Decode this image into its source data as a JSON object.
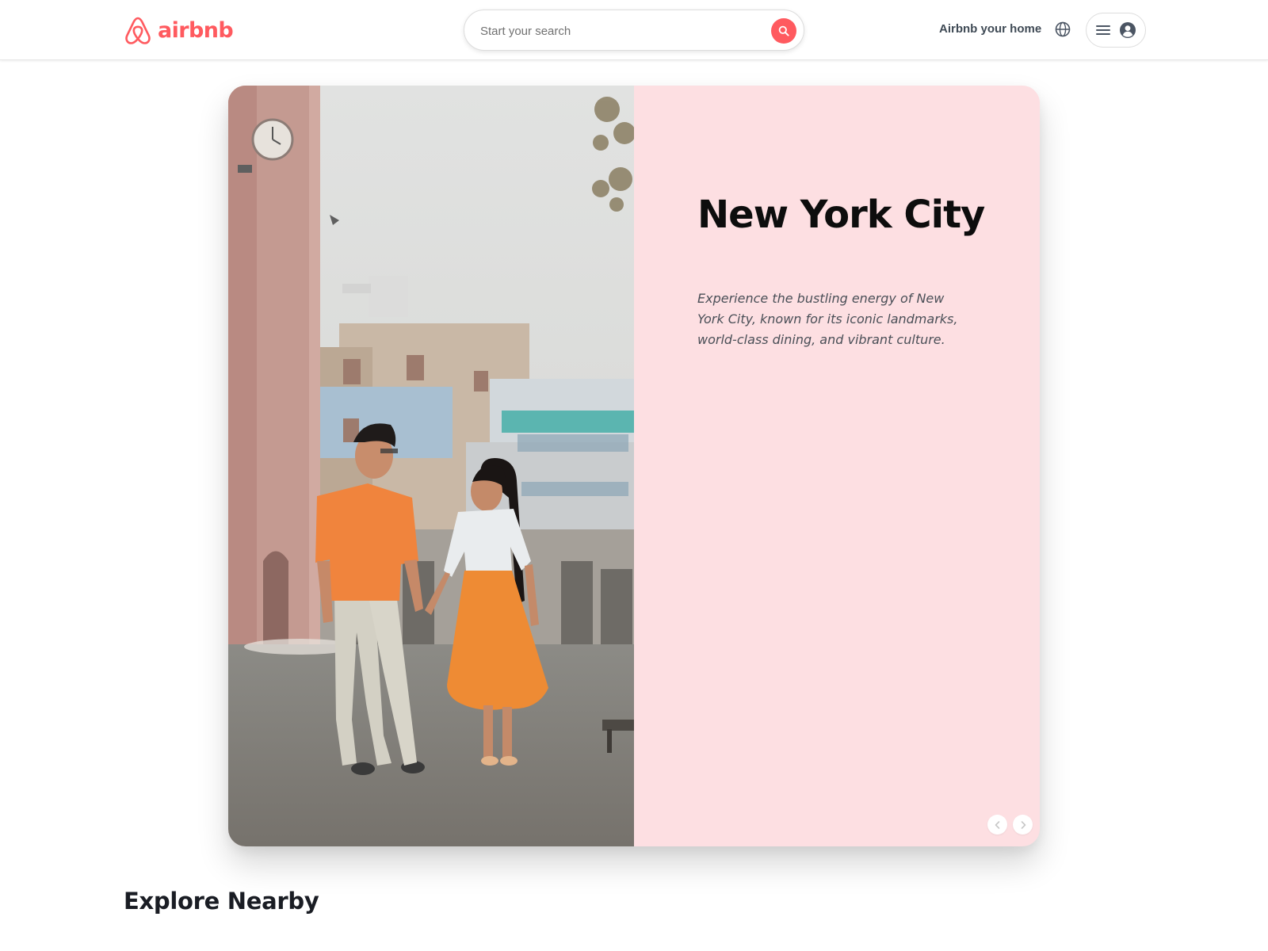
{
  "colors": {
    "brand": "#FF5A5F",
    "hero_panel_bg": "#FDDFE2",
    "text_dark": "#0D0D0D",
    "text_muted": "#4A4F57"
  },
  "header": {
    "logo_text": "airbnb",
    "logo_icon": "airbnb-belo-icon",
    "search_placeholder": "Start your search",
    "search_icon": "search-icon",
    "host_link": "Airbnb your home",
    "globe_icon": "globe-icon",
    "menu_icon": "hamburger-menu-icon",
    "profile_icon": "user-avatar-icon"
  },
  "hero": {
    "title": "New York City",
    "description": "Experience the bustling energy of New York City, known for its iconic landmarks, world-class dining, and vibrant culture.",
    "image_description": "couple walking hand in hand on a street near a pink clock tower",
    "prev_icon": "chevron-left-icon",
    "next_icon": "chevron-right-icon"
  },
  "sections": {
    "explore_title": "Explore Nearby"
  }
}
